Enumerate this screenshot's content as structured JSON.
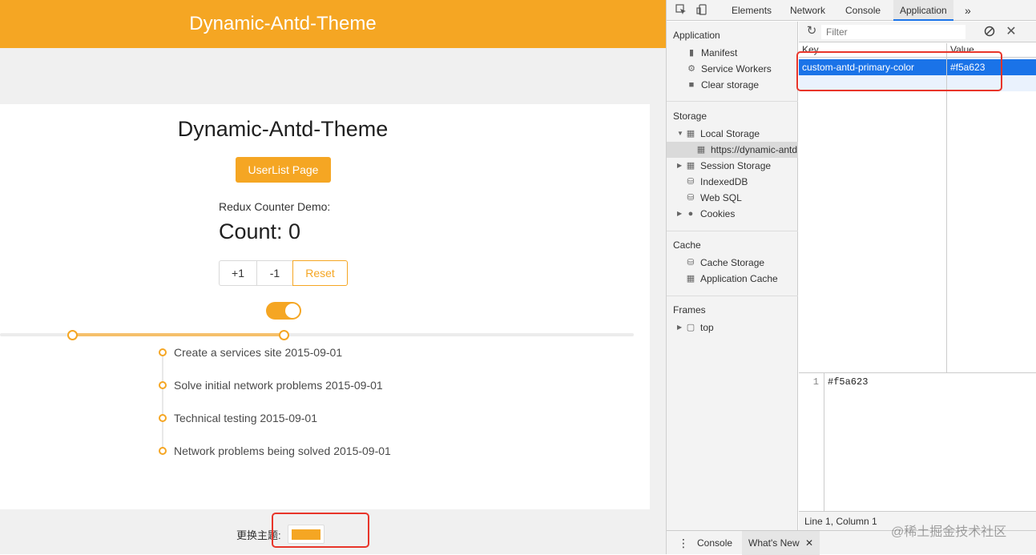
{
  "page": {
    "header_title": "Dynamic-Antd-Theme",
    "card_title": "Dynamic-Antd-Theme",
    "userlist_button": "UserList Page",
    "redux_label": "Redux Counter Demo:",
    "count_label": "Count: 0",
    "buttons": {
      "plus": "+1",
      "minus": "-1",
      "reset": "Reset"
    },
    "toggle_on": true,
    "timeline": [
      "Create a services site 2015-09-01",
      "Solve initial network problems 2015-09-01",
      "Technical testing 2015-09-01",
      "Network problems being solved 2015-09-01"
    ],
    "theme_label": "更换主题:",
    "theme_color": "#f5a623"
  },
  "devtools": {
    "tabs": [
      "Elements",
      "Network",
      "Console",
      "Application"
    ],
    "more_tabs": "»",
    "active_tab": "Application",
    "sidebar": {
      "application_section": "Application",
      "application_items": [
        "Manifest",
        "Service Workers",
        "Clear storage"
      ],
      "storage_section": "Storage",
      "local_storage": "Local Storage",
      "origin": "https://dynamic-antd",
      "session_storage": "Session Storage",
      "indexeddb": "IndexedDB",
      "web_sql": "Web SQL",
      "cookies": "Cookies",
      "cache_section": "Cache",
      "cache_storage": "Cache Storage",
      "application_cache": "Application Cache",
      "frames_section": "Frames",
      "frame_top": "top"
    },
    "filter_placeholder": "Filter",
    "columns": {
      "key": "Key",
      "value": "Value"
    },
    "row": {
      "key": "custom-antd-primary-color",
      "value": "#f5a623"
    },
    "preview": {
      "line_number": "1",
      "value": "#f5a623"
    },
    "status": "Line 1, Column 1",
    "drawer_tabs": {
      "console": "Console",
      "whats_new": "What's New"
    }
  },
  "watermark": "@稀土掘金技术社区",
  "colors": {
    "primary": "#f5a623",
    "selection": "#1a73e8",
    "highlight": "#e8352a"
  }
}
